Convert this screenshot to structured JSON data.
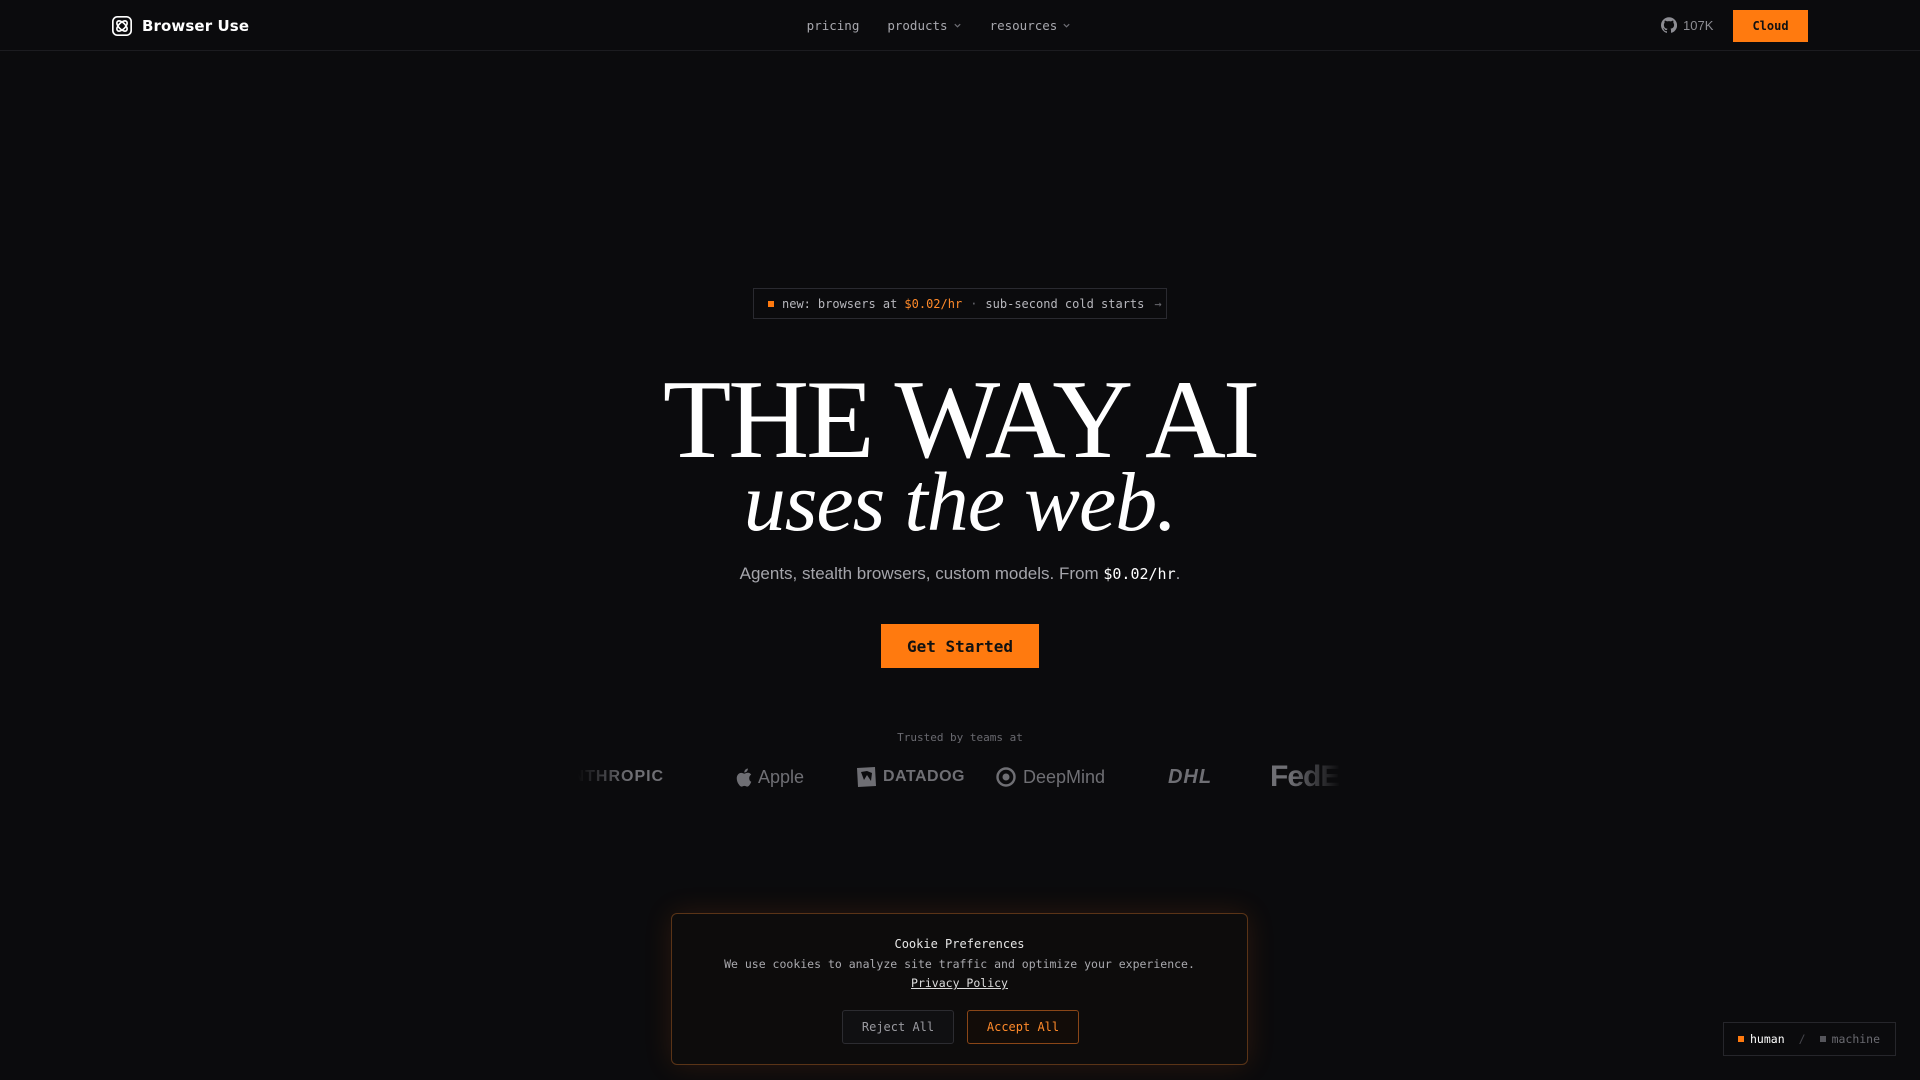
{
  "header": {
    "brand_name": "Browser Use",
    "nav": [
      {
        "label": "pricing",
        "has_dropdown": false
      },
      {
        "label": "products",
        "has_dropdown": true
      },
      {
        "label": "resources",
        "has_dropdown": true
      }
    ],
    "github_stars": "107K",
    "cloud_label": "Cloud"
  },
  "announcement": {
    "prefix": "new:",
    "text": "browsers at",
    "price": "$0.02/hr",
    "separator": "·",
    "suffix": "sub-second cold starts",
    "arrow": "→"
  },
  "hero": {
    "title": "THE WAY AI",
    "subtitle": "uses the web.",
    "tagline_text": "Agents, stealth browsers, custom models. From ",
    "tagline_price": "$0.02/hr",
    "tagline_end": ".",
    "cta_label": "Get Started"
  },
  "trusted": {
    "label": "Trusted by teams at",
    "logos": [
      "ANTHROPIC",
      "Apple",
      "DATADOG",
      "DeepMind",
      "DHL",
      "FedEx"
    ]
  },
  "cookie": {
    "title": "Cookie Preferences",
    "text": "We use cookies to analyze site traffic and optimize your experience.",
    "link": "Privacy Policy",
    "reject_label": "Reject All",
    "accept_label": "Accept All"
  },
  "mode_toggle": {
    "human": "human",
    "separator": "/",
    "machine": "machine",
    "active": "human"
  },
  "colors": {
    "accent": "#ff7a0f",
    "background": "#0b0b0d"
  }
}
